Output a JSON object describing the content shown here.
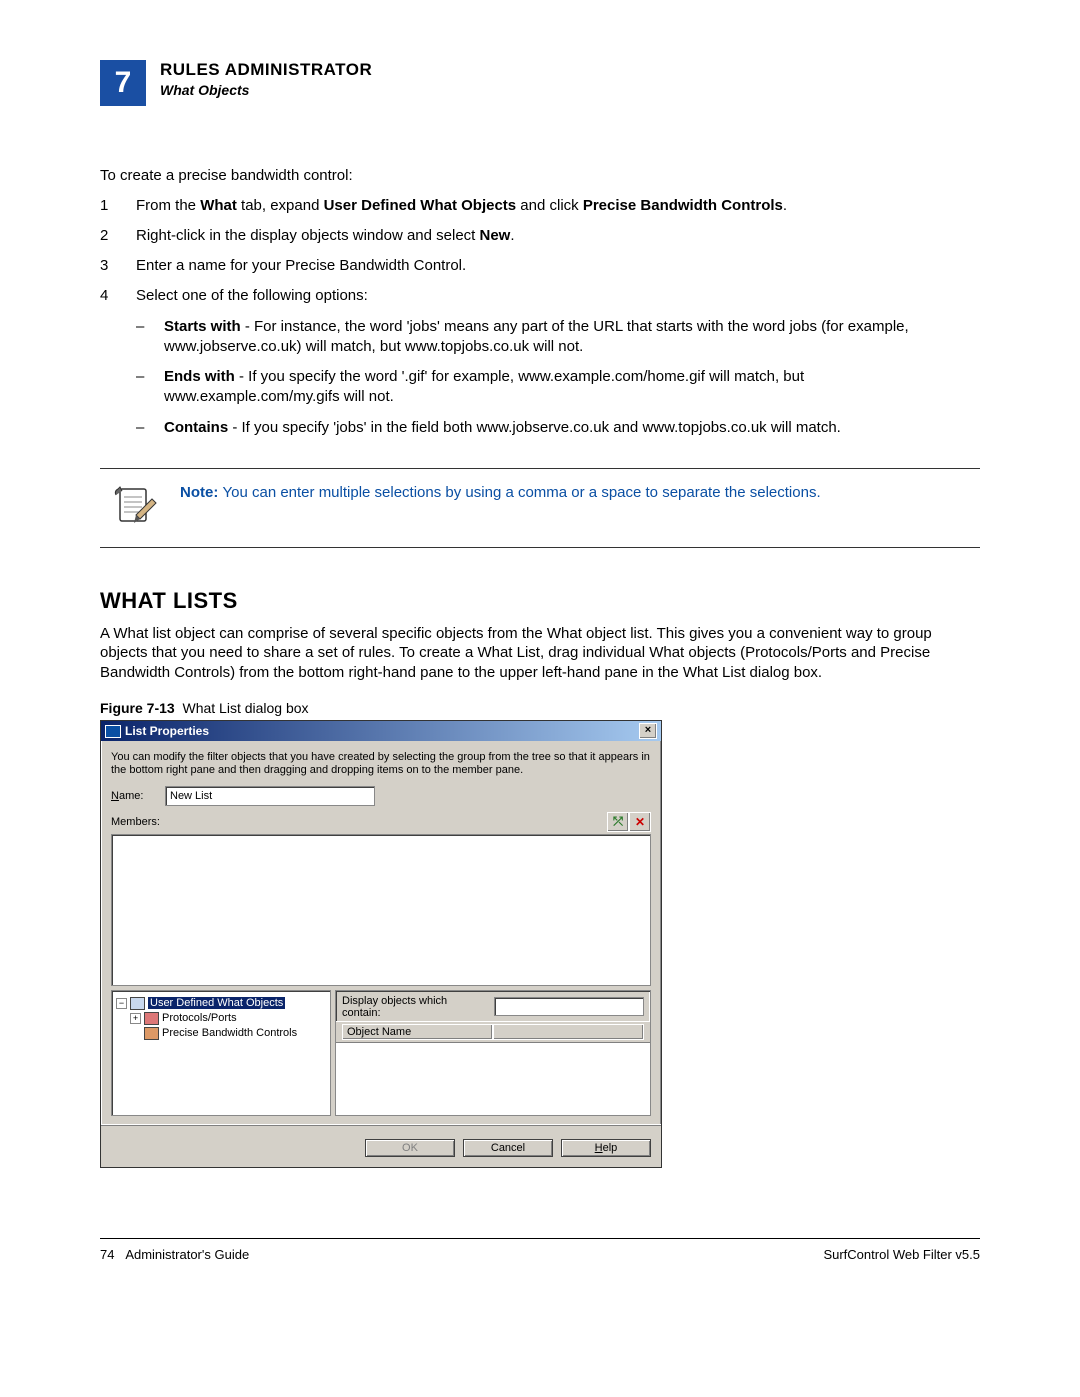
{
  "header": {
    "chapter_number": "7",
    "title": "RULES ADMINISTRATOR",
    "subtitle": "What Objects"
  },
  "intro": "To create a precise bandwidth control:",
  "steps": {
    "s1_pre": "From the ",
    "s1_b1": "What",
    "s1_mid1": " tab, expand ",
    "s1_b2": "User Defined What Objects",
    "s1_mid2": " and click ",
    "s1_b3": "Precise Bandwidth Controls",
    "s1_post": ".",
    "s2_pre": "Right-click in the display objects window and select ",
    "s2_b1": "New",
    "s2_post": ".",
    "s3": "Enter a name for your Precise Bandwidth Control.",
    "s4": "Select one of the following options:",
    "sub1_b": "Starts with",
    "sub1_text": " - For instance, the word 'jobs' means any part of the URL that starts with the word jobs (for example, www.jobserve.co.uk) will match, but www.topjobs.co.uk will not.",
    "sub2_b": "Ends with",
    "sub2_text": " - If you specify the word '.gif' for example, www.example.com/home.gif will match, but www.example.com/my.gifs will not.",
    "sub3_b": "Contains",
    "sub3_text": " - If you specify 'jobs' in the field both www.jobserve.co.uk and www.topjobs.co.uk will match."
  },
  "note": {
    "label": "Note: ",
    "text": "You can enter multiple selections by using a comma or a space to separate the selections."
  },
  "section_heading": "WHAT LISTS",
  "section_body": "A What list object can comprise of several specific objects from the What object list. This gives you a convenient way to group objects that you need to share a set of rules. To create a What List, drag individual What objects (Protocols/Ports and Precise Bandwidth Controls) from the bottom right-hand pane to the upper left-hand pane in the What List dialog box.",
  "figure": {
    "label": "Figure 7-13",
    "caption": "What List dialog box"
  },
  "dialog": {
    "title": "List Properties",
    "description": "You can modify the filter objects that you have created by selecting the group from the tree so that it appears in the bottom right pane and then dragging and dropping items on to the member pane.",
    "name_label_accel": "N",
    "name_label_rest": "ame:",
    "name_value": "New List",
    "members_label_accel": "M",
    "members_label_rest": "embers:",
    "tree": {
      "root": "User Defined What Objects",
      "item1": "Protocols/Ports",
      "item2": "Precise Bandwidth Controls"
    },
    "filter_label": "Display objects which contain:",
    "column_header": "Object Name",
    "buttons": {
      "ok": "OK",
      "cancel": "Cancel",
      "help_accel": "H",
      "help_rest": "elp"
    }
  },
  "footer": {
    "left_page": "74",
    "left_text": "Administrator's Guide",
    "right": "SurfControl Web Filter v5.5"
  }
}
